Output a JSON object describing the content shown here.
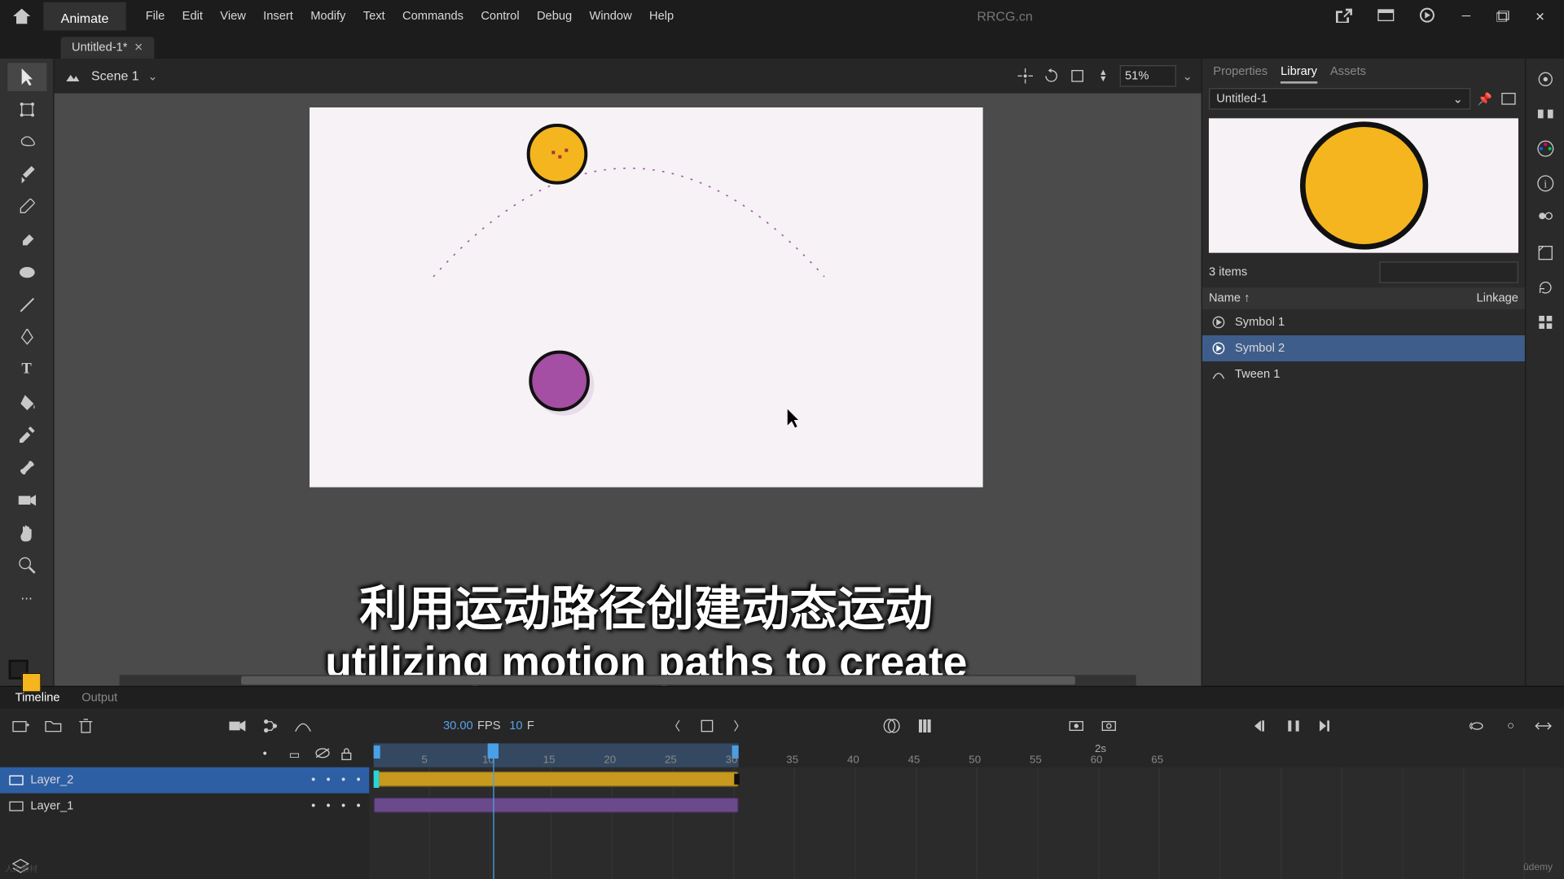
{
  "titlebar": {
    "app_tab": "Animate",
    "center_text": "RRCG.cn",
    "menu": [
      "File",
      "Edit",
      "View",
      "Insert",
      "Modify",
      "Text",
      "Commands",
      "Control",
      "Debug",
      "Window",
      "Help"
    ]
  },
  "doc": {
    "name": "Untitled-1*"
  },
  "scene": {
    "name": "Scene 1",
    "zoom": "51%"
  },
  "library": {
    "tabs": [
      "Properties",
      "Library",
      "Assets"
    ],
    "active_tab": 1,
    "dropdown": "Untitled-1",
    "count_label": "3 items",
    "search_placeholder": "",
    "columns": {
      "name": "Name",
      "linkage": "Linkage"
    },
    "items": [
      {
        "name": "Symbol 1",
        "selected": false
      },
      {
        "name": "Symbol 2",
        "selected": true
      },
      {
        "name": "Tween 1",
        "selected": false
      }
    ]
  },
  "timeline": {
    "tabs": [
      "Timeline",
      "Output"
    ],
    "active_tab": 0,
    "fps": "30.00",
    "fps_label": "FPS",
    "frame": "10",
    "frame_suffix": "F",
    "ruler_ticks": [
      5,
      10,
      15,
      20,
      25,
      30,
      35,
      40,
      45,
      50,
      55,
      60,
      65
    ],
    "span_end_label": "2s",
    "layers": [
      {
        "name": "Layer_2",
        "selected": true,
        "tween": "yellow"
      },
      {
        "name": "Layer_1",
        "selected": false,
        "tween": "purple"
      }
    ]
  },
  "colors": {
    "accent": "#4aa0e6",
    "yellow": "#f4b51f",
    "purple": "#a44ea4",
    "bg_dark": "#1c1c1c",
    "bg_mid": "#323232"
  },
  "subtitles": {
    "cn": "利用运动路径创建动态运动",
    "en": "utilizing motion paths to create dynamic movement"
  },
  "watermark": "ûdemy"
}
